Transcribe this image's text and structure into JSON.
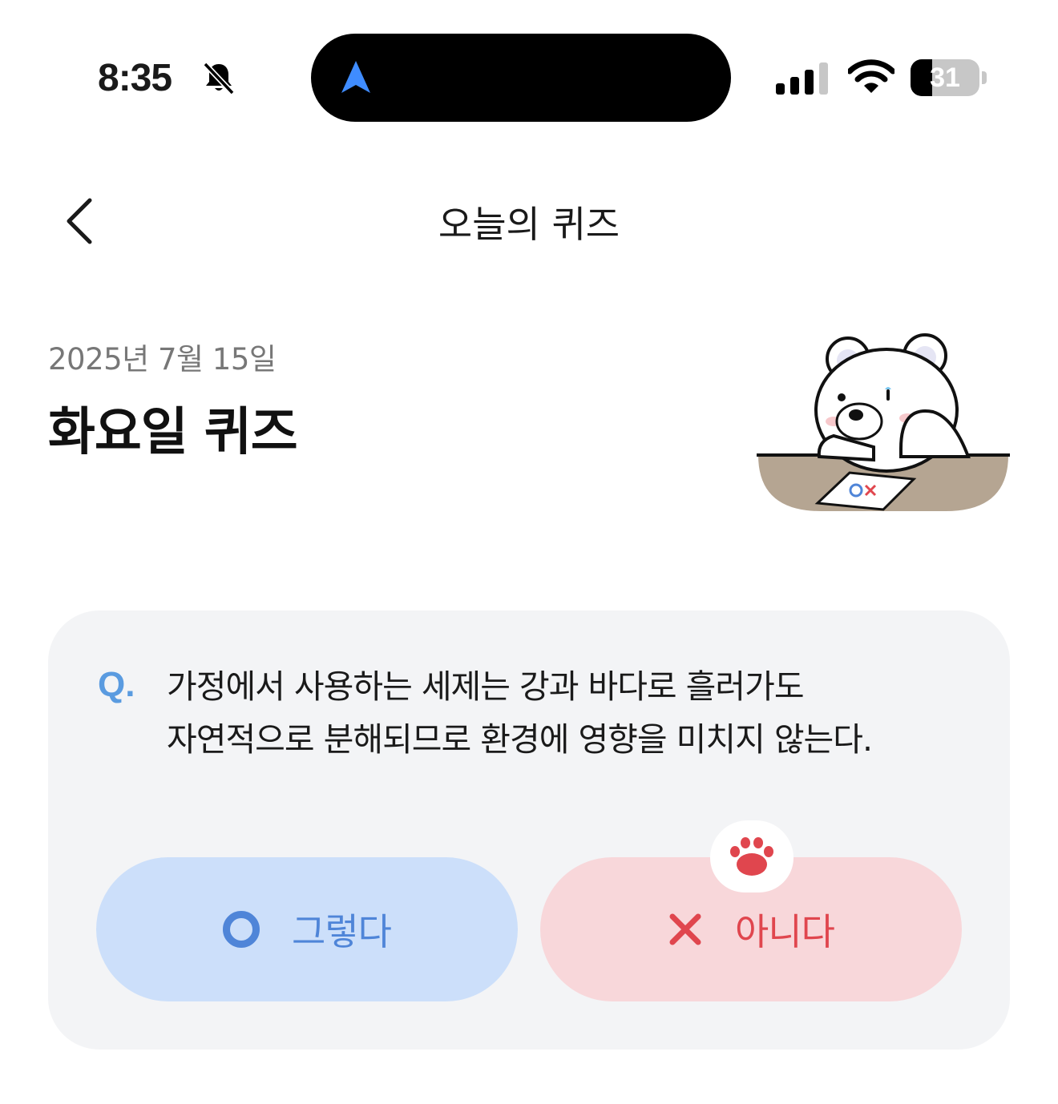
{
  "status_bar": {
    "time": "8:35",
    "battery_level": "31",
    "battery_fraction": 0.31,
    "icons": [
      "bell-slash-icon",
      "location-arrow-icon",
      "cellular-signal-icon",
      "wifi-icon",
      "battery-icon"
    ]
  },
  "nav": {
    "title": "오늘의 퀴즈",
    "back_icon": "chevron-left-icon"
  },
  "header": {
    "date": "2025년 7월 15일",
    "title": "화요일 퀴즈"
  },
  "quiz": {
    "q_label": "Q.",
    "question_line1": "가정에서 사용하는 세제는 강과 바다로 흘러가도",
    "question_line2": "자연적으로 분해되므로 환경에 영향을 미치지 않는다.",
    "options": [
      {
        "label": "그렇다",
        "icon": "circle-o-icon",
        "color": "#4f85d8",
        "bg": "#ccdffa"
      },
      {
        "label": "아니다",
        "icon": "x-mark-icon",
        "color": "#e0464e",
        "bg": "#f8d7da"
      }
    ],
    "badge_icon": "paw-icon"
  },
  "colors": {
    "accent_blue": "#5a9be0",
    "card_bg": "#f3f4f6"
  }
}
